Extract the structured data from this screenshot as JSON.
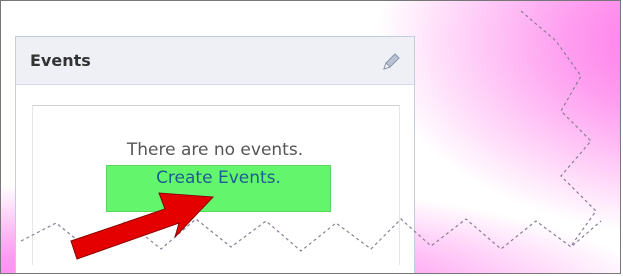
{
  "widget": {
    "title": "Events",
    "empty_message": "There are no events.",
    "create_link_label": "Create Events."
  },
  "colors": {
    "highlight": "#63f56b",
    "link": "#1c5d93",
    "arrow": "#e40000",
    "glow": "#ff6ee6"
  },
  "icons": {
    "edit": "pencil-icon",
    "annotation": "red-arrow"
  }
}
